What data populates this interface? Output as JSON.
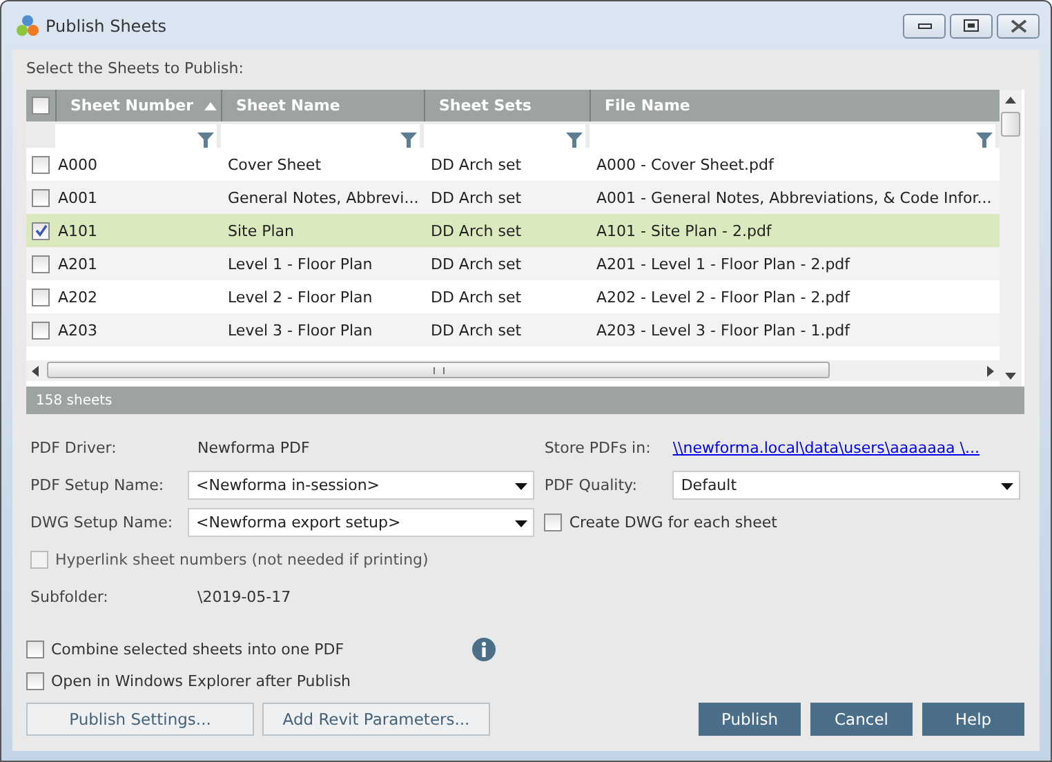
{
  "window": {
    "title": "Publish Sheets"
  },
  "instruction": "Select the Sheets to Publish:",
  "table": {
    "select_all_checked": false,
    "columns": [
      {
        "label": "Sheet Number",
        "sorted": true
      },
      {
        "label": "Sheet Name",
        "sorted": false
      },
      {
        "label": "Sheet Sets",
        "sorted": false
      },
      {
        "label": "File Name",
        "sorted": false
      }
    ],
    "rows": [
      {
        "cells": [
          "A000",
          "Cover Sheet",
          "DD Arch set",
          "A000 - Cover Sheet.pdf"
        ],
        "checked": false,
        "selected": false
      },
      {
        "cells": [
          "A001",
          "General Notes, Abbrevi...",
          "DD Arch set",
          "A001 - General Notes, Abbreviations, & Code Infor..."
        ],
        "checked": false,
        "selected": false
      },
      {
        "cells": [
          "A101",
          "Site Plan",
          "DD Arch set",
          "A101 - Site Plan - 2.pdf"
        ],
        "checked": true,
        "selected": true
      },
      {
        "cells": [
          "A201",
          "Level 1 - Floor Plan",
          "DD Arch set",
          "A201 - Level 1 - Floor Plan - 2.pdf"
        ],
        "checked": false,
        "selected": false
      },
      {
        "cells": [
          "A202",
          "Level 2 - Floor Plan",
          "DD Arch set",
          "A202 - Level 2 - Floor Plan - 2.pdf"
        ],
        "checked": false,
        "selected": false
      },
      {
        "cells": [
          "A203",
          "Level 3 - Floor Plan",
          "DD Arch set",
          "A203 - Level 3 - Floor Plan - 1.pdf"
        ],
        "checked": false,
        "selected": false
      }
    ],
    "count": "158 sheets"
  },
  "settings": {
    "pdf_driver": {
      "label": "PDF Driver:",
      "value": "Newforma PDF"
    },
    "pdf_setup": {
      "label": "PDF Setup Name:",
      "value": "<Newforma in-session>"
    },
    "dwg_setup": {
      "label": "DWG Setup Name:",
      "value": "<Newforma export setup>"
    },
    "hyperlink": {
      "label": "Hyperlink sheet numbers (not needed if printing)",
      "checked": false,
      "disabled": true
    },
    "subfolder": {
      "label": "Subfolder:",
      "value": "\\2019-05-17"
    },
    "store": {
      "label": "Store PDFs in:",
      "link": "\\\\newforma.local\\data\\users\\aaaaaaa \\..."
    },
    "pdf_quality": {
      "label": "PDF Quality:",
      "value": "Default"
    },
    "create_dwg": {
      "label": "Create DWG for each sheet",
      "checked": false
    }
  },
  "options": [
    {
      "label": "Combine selected sheets into one PDF",
      "checked": false,
      "info": true
    },
    {
      "label": "Open in Windows Explorer after Publish",
      "checked": false,
      "info": false
    }
  ],
  "secondary_buttons": [
    "Publish Settings...",
    "Add Revit Parameters..."
  ],
  "primary_buttons": [
    "Publish",
    "Cancel",
    "Help"
  ]
}
